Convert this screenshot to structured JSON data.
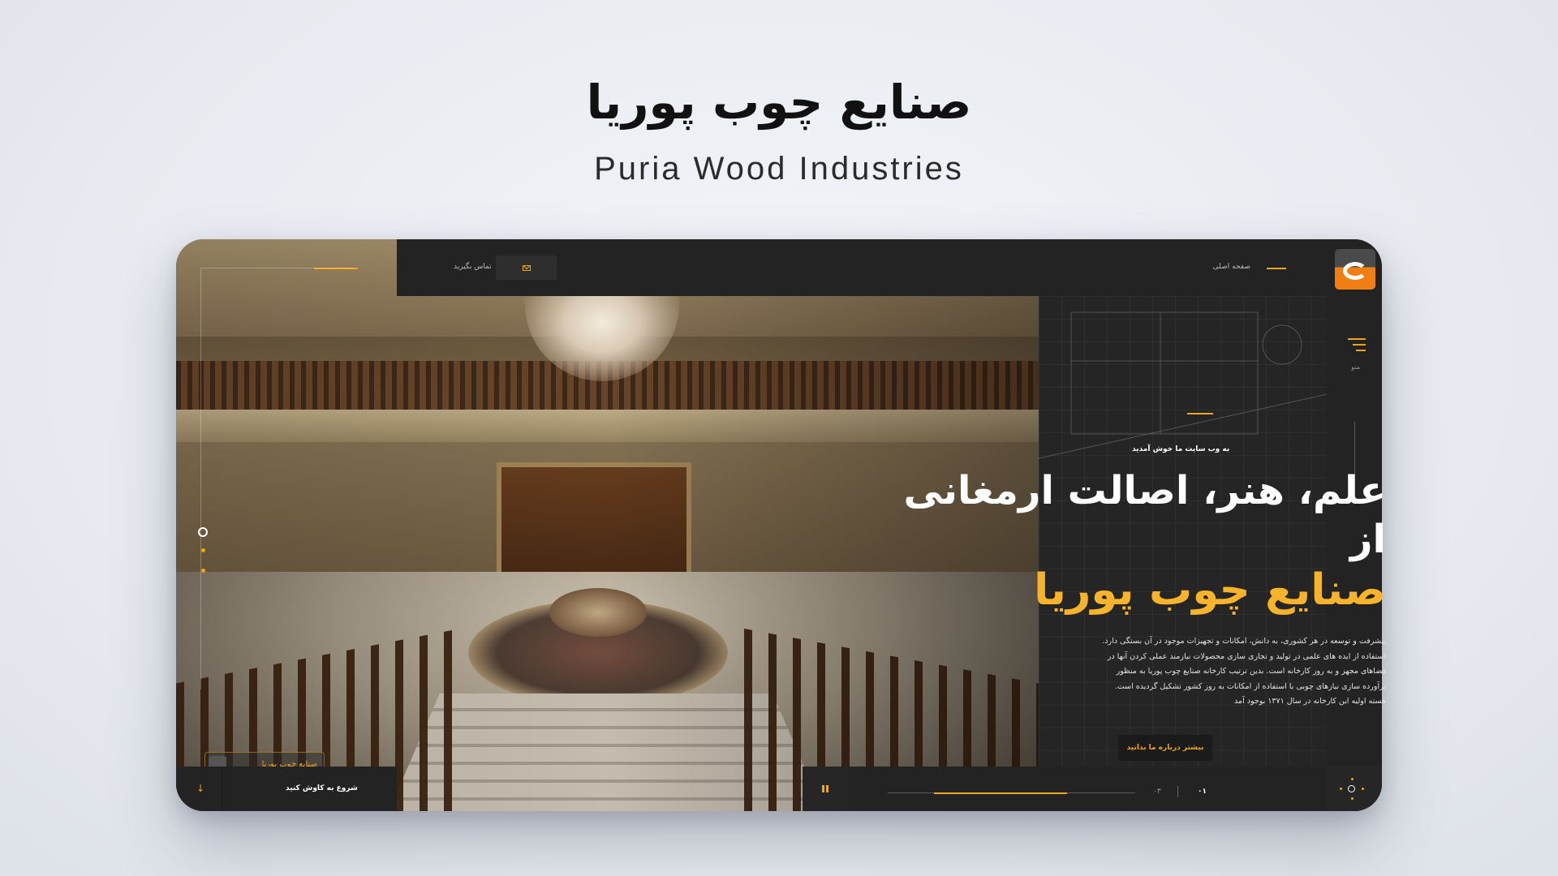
{
  "showcase": {
    "title": "صنایع چوب پوریا",
    "subtitle": "Puria Wood Industries"
  },
  "header": {
    "contact_label": "تماس بگیرید",
    "home_label": "صفحه اصلی"
  },
  "side_menu": {
    "label": "منو"
  },
  "hero": {
    "welcome": "به وب سایت ما خوش آمدید",
    "headline_line1": "علم، هنر، اصالت ارمغانی",
    "headline_line2": "از",
    "headline_accent": "صنایع چوب پوریا",
    "paragraph": "پیشرفت و توسعه در هر کشوری، به دانش، امکانات و تجهیزات موجود در آن بستگی دارد. استفاده از ایده های علمی در تولید و تجاری سازی محصولات نیازمند عملی کردن آنها در فضاهای مجهز و به روز کارخانه است. بدین ترتیب کارخانه صنایع چوب پوریا به منظور برآورده سازی نیازهای چوبی با استفاده از امکانات به روز کشور تشکیل گردیده است. هسته اولیه این کارخانه در سال ۱۳۷۱ بوجود آمد",
    "about_button": "بیشتر درباره ما بدانید",
    "mini_logo_text": "صنایع چوب پوریا"
  },
  "slider": {
    "scroll_label": "شروع به کاوش کنید",
    "current": "۰۱",
    "total": "۰۳",
    "progress": 0.66,
    "prev_arrow": "‹",
    "next_arrow": "›"
  },
  "colors": {
    "accent": "#f2a51a",
    "accent_text": "#f7b32b",
    "panel": "#232323",
    "logo_orange": "#f07e12"
  },
  "icons": [
    "mail-icon",
    "menu-icon",
    "pause-icon",
    "scroll-down-icon",
    "logo-icon"
  ]
}
